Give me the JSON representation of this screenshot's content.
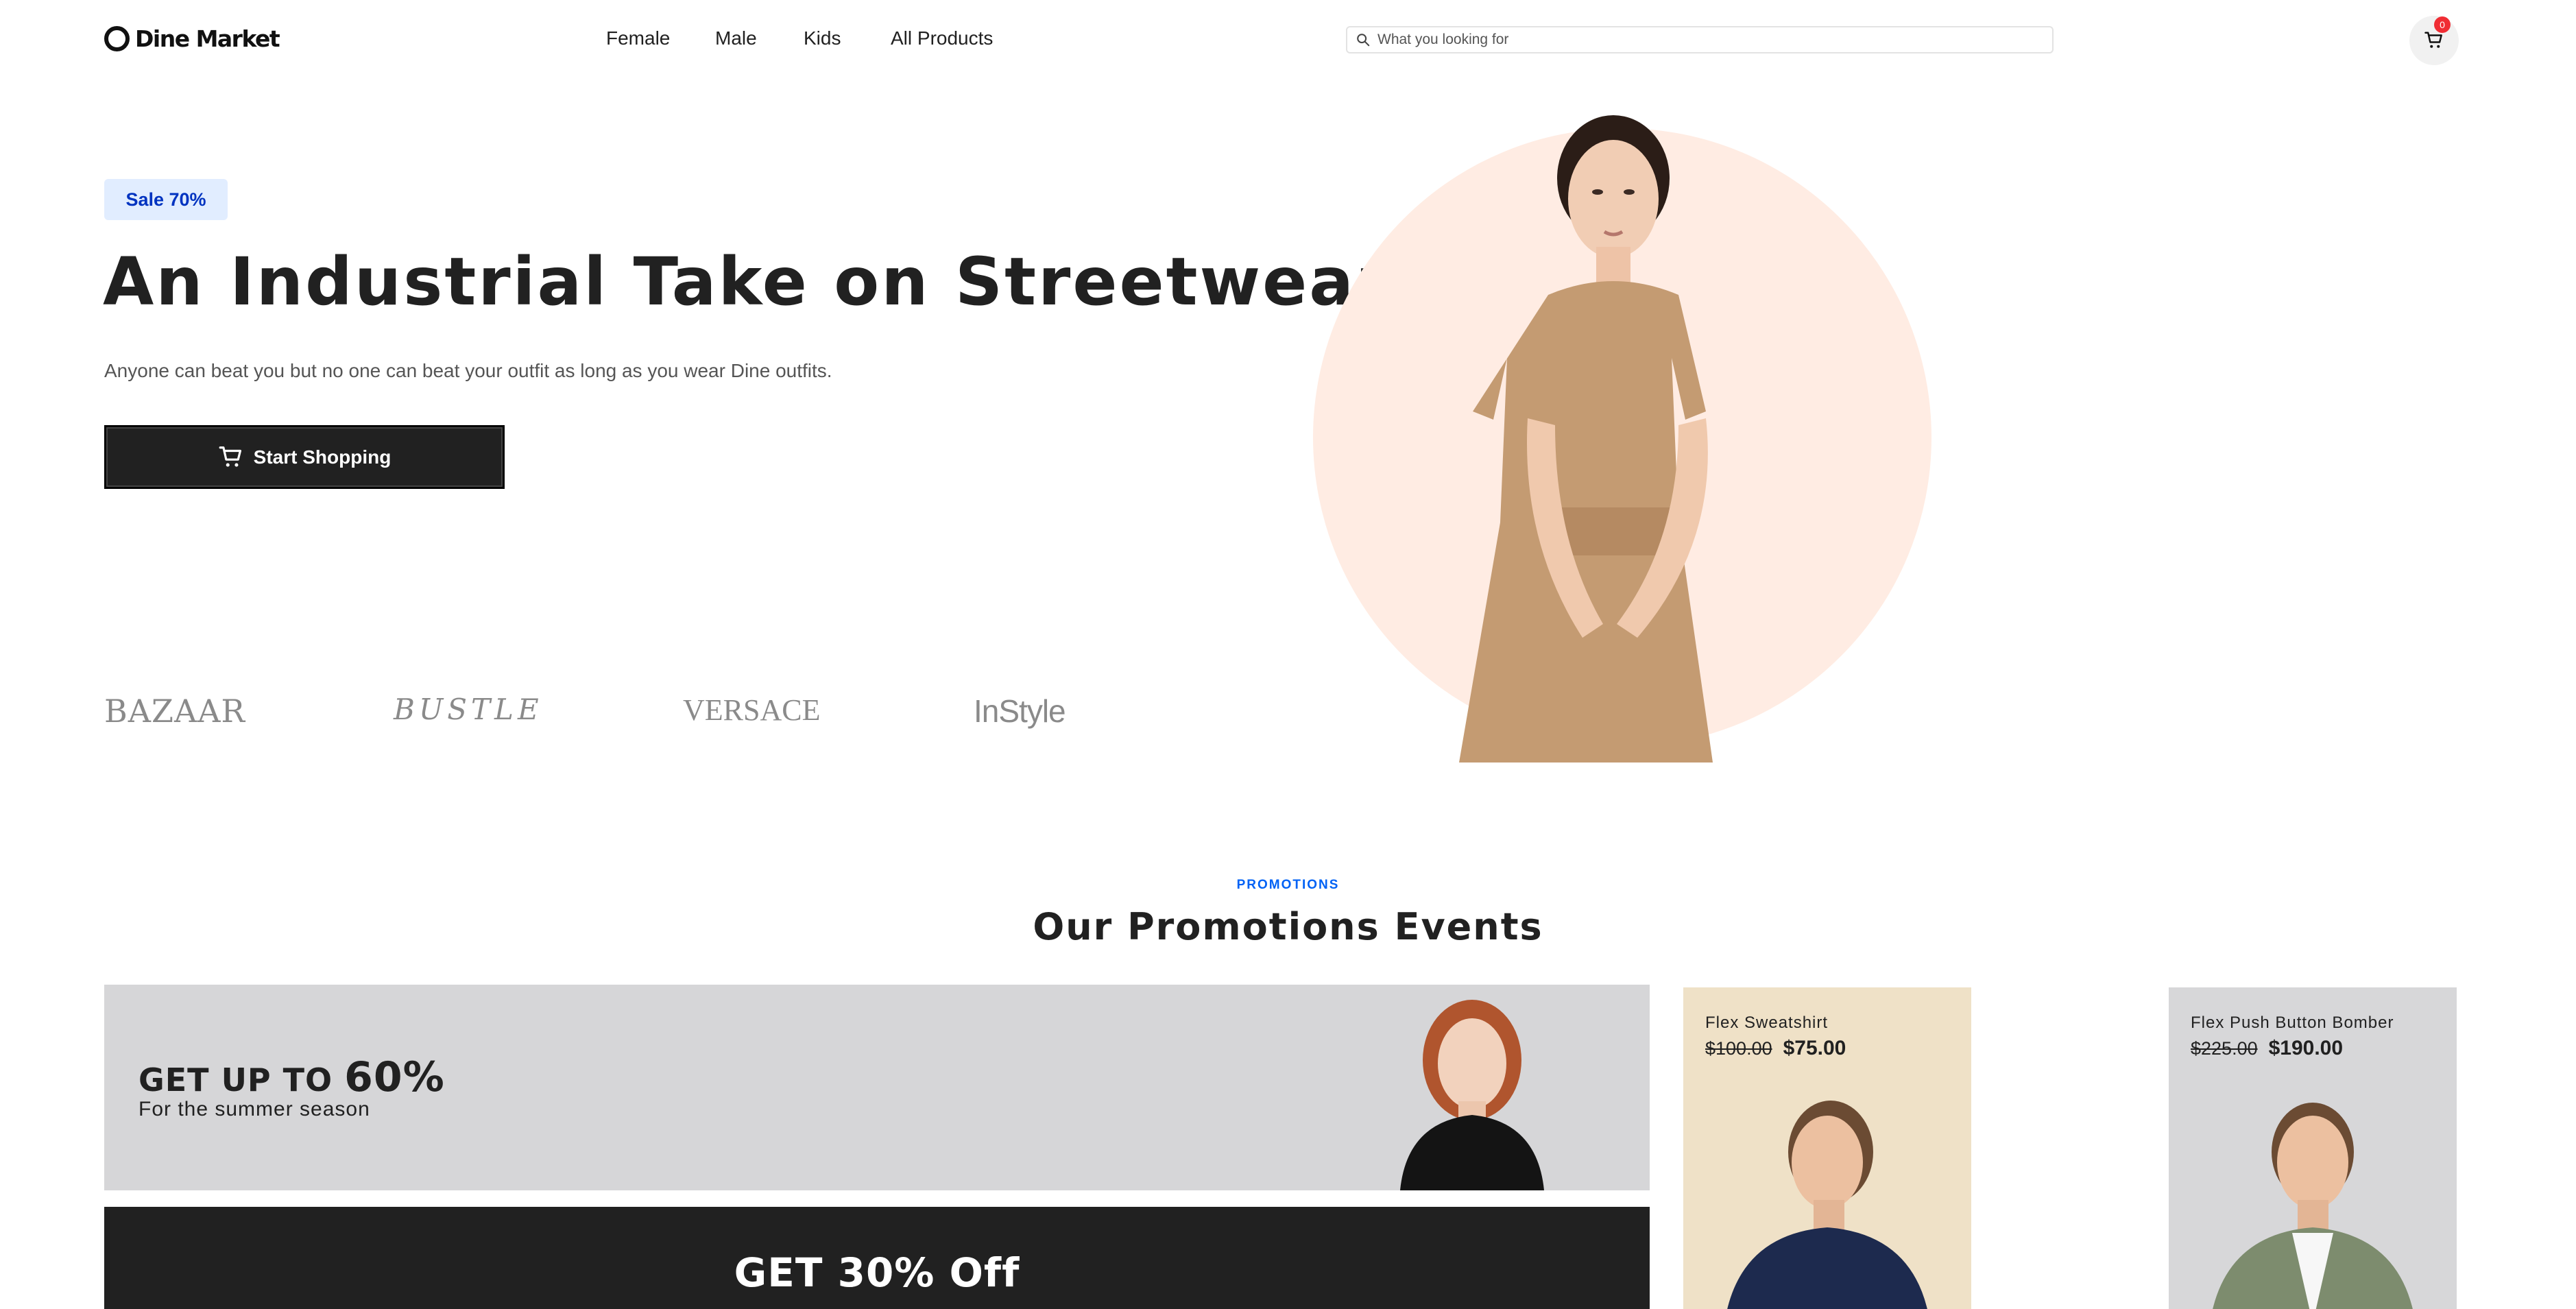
{
  "header": {
    "logo_text": "Dine Market",
    "nav": [
      "Female",
      "Male",
      "Kids",
      "All Products"
    ],
    "search_placeholder": "What you looking for",
    "cart_count": "0"
  },
  "hero": {
    "badge": "Sale 70%",
    "title": "An Industrial Take on Streetwear",
    "subtitle": "Anyone can beat you but no one can beat your outfit as long as you wear Dine outfits.",
    "cta": "Start Shopping",
    "brands": [
      "BAZAAR",
      "BUSTLE",
      "VERSACE",
      "InStyle"
    ]
  },
  "promotions": {
    "label": "PROMOTIONS",
    "title": "Our Promotions Events",
    "card1": {
      "headline_prefix": "GET UP TO",
      "headline_value": "60%",
      "sub": "For the summer season"
    },
    "card2": {
      "headline": "GET 30% Off"
    },
    "products": [
      {
        "name": "Flex Sweatshirt",
        "old_price": "$100.00",
        "new_price": "$75.00"
      },
      {
        "name": "Flex Push Button Bomber",
        "old_price": "$225.00",
        "new_price": "$190.00"
      }
    ]
  },
  "colors": {
    "accent_blue": "#0062f5",
    "badge_bg": "#e1edff",
    "dark": "#212121",
    "hero_circle": "#ffece3",
    "cart_badge": "#f02d34"
  },
  "icons": [
    "search-icon",
    "cart-icon"
  ]
}
